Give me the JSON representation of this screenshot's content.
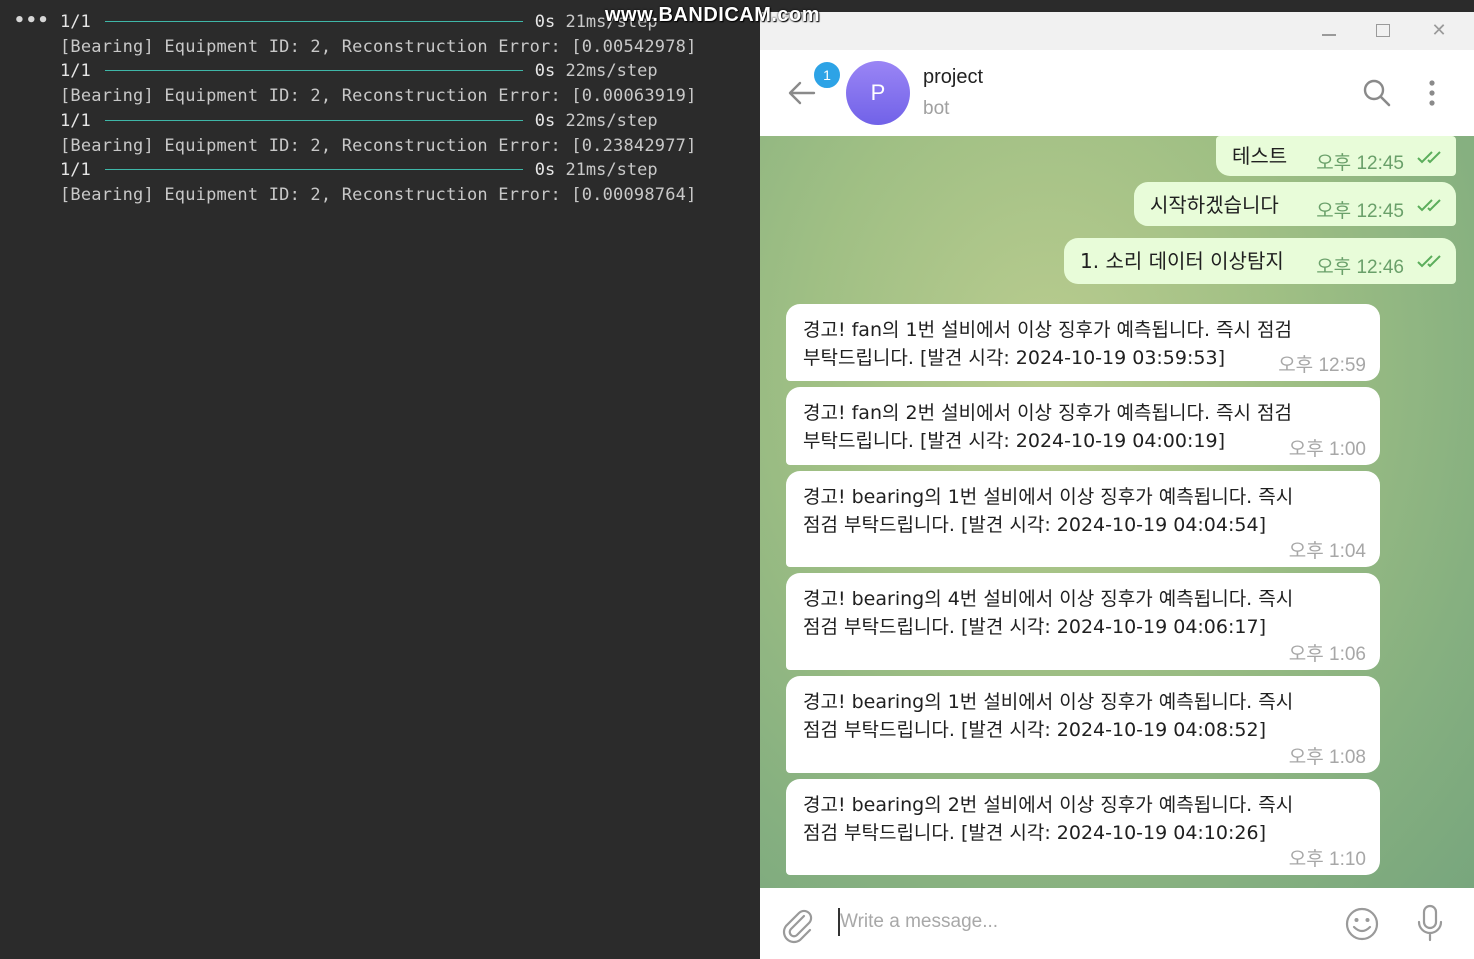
{
  "terminal": {
    "dots": "•••",
    "lines": [
      {
        "kind": "progress",
        "batch": "1/1",
        "time": "0s",
        "speed": "21ms/step"
      },
      {
        "kind": "log",
        "text": "[Bearing] Equipment ID: 2, Reconstruction Error: [0.00542978]"
      },
      {
        "kind": "progress",
        "batch": "1/1",
        "time": "0s",
        "speed": "22ms/step"
      },
      {
        "kind": "log",
        "text": "[Bearing] Equipment ID: 2, Reconstruction Error: [0.00063919]"
      },
      {
        "kind": "progress",
        "batch": "1/1",
        "time": "0s",
        "speed": "22ms/step"
      },
      {
        "kind": "log",
        "text": "[Bearing] Equipment ID: 2, Reconstruction Error: [0.23842977]"
      },
      {
        "kind": "progress",
        "batch": "1/1",
        "time": "0s",
        "speed": "21ms/step"
      },
      {
        "kind": "log",
        "text": "[Bearing] Equipment ID: 2, Reconstruction Error: [0.00098764]"
      }
    ]
  },
  "watermark": "www.BANDICAM.com",
  "telegram": {
    "header": {
      "unread_count": "1",
      "avatar_letter": "P",
      "title": "project",
      "subtitle": "bot"
    },
    "outgoing": [
      {
        "text": "테스트",
        "time": "오후 12:45"
      },
      {
        "text": "시작하겠습니다",
        "time": "오후 12:45"
      },
      {
        "text": "1. 소리 데이터 이상탐지",
        "time": "오후 12:46"
      }
    ],
    "incoming": [
      {
        "line1": "경고! fan의 1번 설비에서 이상 징후가 예측됩니다. 즉시 점검",
        "line2": "부탁드립니다. [발견 시각: 2024-10-19 03:59:53]",
        "time": "오후 12:59"
      },
      {
        "line1": "경고! fan의 2번 설비에서 이상 징후가 예측됩니다. 즉시 점검",
        "line2": "부탁드립니다. [발견 시각: 2024-10-19 04:00:19]",
        "time": "오후 1:00"
      },
      {
        "line1": "경고! bearing의 1번 설비에서 이상 징후가 예측됩니다. 즉시",
        "line2": "점검 부탁드립니다. [발견 시각: 2024-10-19 04:04:54]",
        "time": "오후 1:04"
      },
      {
        "line1": "경고! bearing의 4번 설비에서 이상 징후가 예측됩니다. 즉시",
        "line2": "점검 부탁드립니다. [발견 시각: 2024-10-19 04:06:17]",
        "time": "오후 1:06"
      },
      {
        "line1": "경고! bearing의 1번 설비에서 이상 징후가 예측됩니다. 즉시",
        "line2": "점검 부탁드립니다. [발견 시각: 2024-10-19 04:08:52]",
        "time": "오후 1:08"
      },
      {
        "line1": "경고! bearing의 2번 설비에서 이상 징후가 예측됩니다. 즉시",
        "line2": "점검 부탁드립니다. [발견 시각: 2024-10-19 04:10:26]",
        "time": "오후 1:10"
      }
    ],
    "composer": {
      "placeholder": "Write a message..."
    }
  }
}
